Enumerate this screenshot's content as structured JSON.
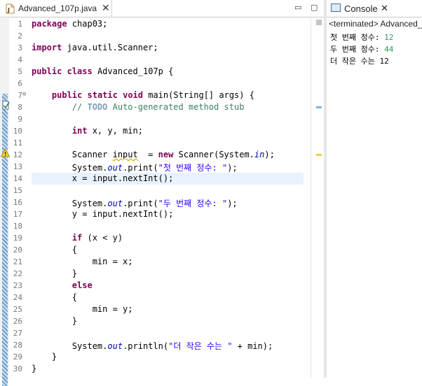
{
  "editor": {
    "tab_title": "Advanced_107p.java",
    "tab_close": "✕",
    "minimize": "▭",
    "maximize": "▢",
    "lines": [
      {
        "n": "1",
        "t": "package chap03;"
      },
      {
        "n": "2",
        "t": ""
      },
      {
        "n": "3",
        "t": "import java.util.Scanner;"
      },
      {
        "n": "4",
        "t": ""
      },
      {
        "n": "5",
        "t": "public class Advanced_107p {"
      },
      {
        "n": "6",
        "t": ""
      },
      {
        "n": "7",
        "t": "    public static void main(String[] args) {"
      },
      {
        "n": "8",
        "t": "        // TODO Auto-generated method stub"
      },
      {
        "n": "9",
        "t": ""
      },
      {
        "n": "10",
        "t": "        int x, y, min;"
      },
      {
        "n": "11",
        "t": ""
      },
      {
        "n": "12",
        "t": "        Scanner input  = new Scanner(System.in);"
      },
      {
        "n": "13",
        "t": "        System.out.print(\"첫 번째 정수: \");"
      },
      {
        "n": "14",
        "t": "        x = input.nextInt();"
      },
      {
        "n": "15",
        "t": ""
      },
      {
        "n": "16",
        "t": "        System.out.print(\"두 번째 정수: \");"
      },
      {
        "n": "17",
        "t": "        y = input.nextInt();"
      },
      {
        "n": "18",
        "t": ""
      },
      {
        "n": "19",
        "t": "        if (x < y)"
      },
      {
        "n": "20",
        "t": "        {"
      },
      {
        "n": "21",
        "t": "            min = x;"
      },
      {
        "n": "22",
        "t": "        }"
      },
      {
        "n": "23",
        "t": "        else"
      },
      {
        "n": "24",
        "t": "        {"
      },
      {
        "n": "25",
        "t": "            min = y;"
      },
      {
        "n": "26",
        "t": "        }"
      },
      {
        "n": "27",
        "t": ""
      },
      {
        "n": "28",
        "t": "        System.out.println(\"더 작은 수는 \" + min);"
      },
      {
        "n": "29",
        "t": "    }"
      },
      {
        "n": "30",
        "t": "}"
      }
    ]
  },
  "console": {
    "tab_title": "Console",
    "tab_close": "✕",
    "terminated": "<terminated> Advanced_",
    "output": [
      {
        "prompt": "첫 번째 정수: ",
        "input": "12"
      },
      {
        "prompt": "두 번째 정수: ",
        "input": "44"
      },
      {
        "prompt": "더 작은 수는 12",
        "input": ""
      }
    ]
  }
}
